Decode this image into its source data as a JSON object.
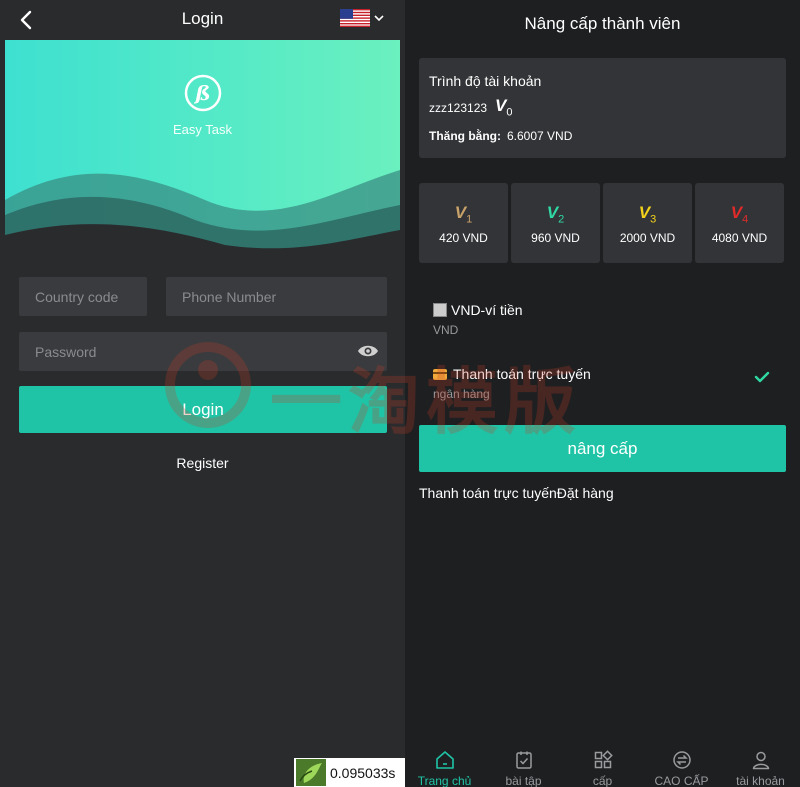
{
  "left": {
    "header": {
      "title": "Login"
    },
    "hero": {
      "app_name": "Easy Task"
    },
    "form": {
      "country_code_placeholder": "Country code",
      "phone_placeholder": "Phone Number",
      "password_placeholder": "Password",
      "login_label": "Login",
      "register_label": "Register"
    },
    "timer": {
      "value": "0.095033s"
    }
  },
  "right": {
    "title": "Nâng cấp thành viên",
    "account": {
      "label": "Trình độ tài khoản",
      "username": "zzz123123",
      "level_mark": "V",
      "level_num": "0",
      "balance_label": "Thăng bằng:",
      "balance_value": "6.6007 VND"
    },
    "levels": [
      {
        "mark": "V",
        "num": "1",
        "price": "420 VND",
        "color": "#c9a26a"
      },
      {
        "mark": "V",
        "num": "2",
        "price": "960 VND",
        "color": "#2fd9a4"
      },
      {
        "mark": "V",
        "num": "3",
        "price": "2000 VND",
        "color": "#f2d21a"
      },
      {
        "mark": "V",
        "num": "4",
        "price": "4080 VND",
        "color": "#e02a2a"
      }
    ],
    "payments": [
      {
        "name": "VND-ví tiền",
        "sub": "VND"
      },
      {
        "name": "Thanh toán trực tuyến",
        "sub": "ngân hàng"
      }
    ],
    "upgrade_label": "nâng cấp",
    "order_link": "Thanh toán trực tuyếnĐặt hàng",
    "nav": [
      {
        "label": "Trang chủ",
        "icon": "home-icon"
      },
      {
        "label": "bài tập",
        "icon": "task-icon"
      },
      {
        "label": "cấp",
        "icon": "grid-icon"
      },
      {
        "label": "CAO CẤP",
        "icon": "exchange-icon"
      },
      {
        "label": "tài khoản",
        "icon": "user-icon"
      }
    ]
  },
  "watermark": {
    "text": "一淘模版"
  },
  "colors": {
    "accent": "#1fc4a6",
    "hero_start": "#3ee0d0",
    "hero_end": "#6bf0bf"
  }
}
